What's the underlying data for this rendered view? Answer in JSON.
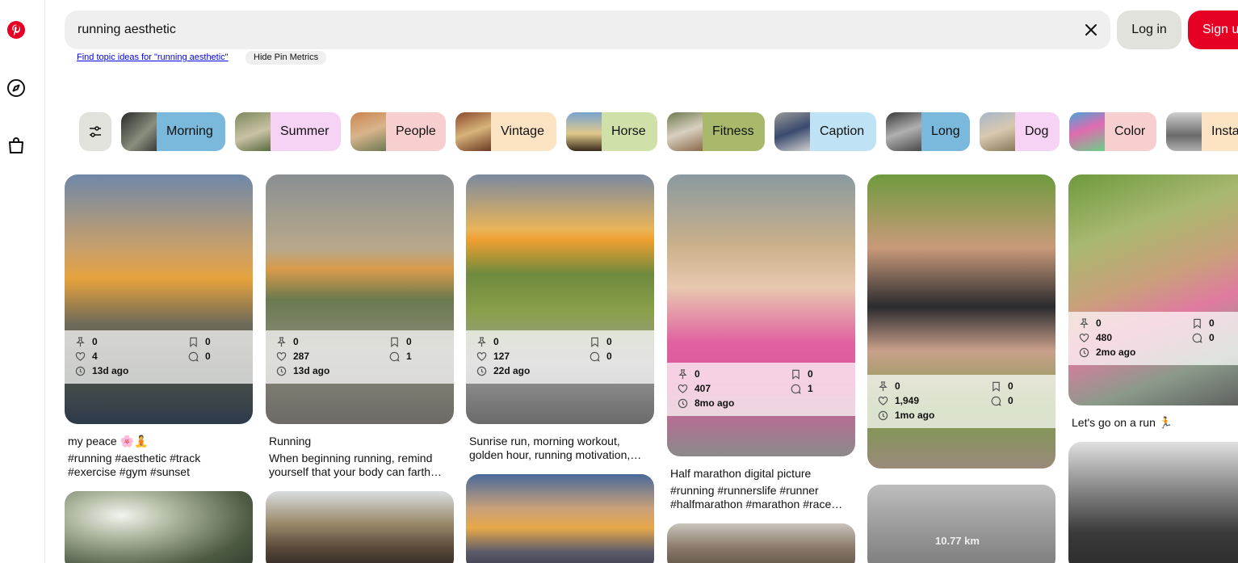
{
  "search": {
    "query": "running aesthetic"
  },
  "header": {
    "login": "Log in",
    "signup": "Sign up"
  },
  "sub": {
    "topic_link": "Find topic ideas for \"running aesthetic\"",
    "hide_metrics": "Hide Pin Metrics"
  },
  "chips": [
    {
      "label": "Morning",
      "color": "#7ab8dc"
    },
    {
      "label": "Summer",
      "color": "#f6d2f4"
    },
    {
      "label": "People",
      "color": "#f8cfcf"
    },
    {
      "label": "Vintage",
      "color": "#fbe3c4"
    },
    {
      "label": "Horse",
      "color": "#cfe0a9"
    },
    {
      "label": "Fitness",
      "color": "#a8b96b"
    },
    {
      "label": "Caption",
      "color": "#bfe3f4"
    },
    {
      "label": "Long",
      "color": "#7ab8dc"
    },
    {
      "label": "Dog",
      "color": "#f6d2f4"
    },
    {
      "label": "Color",
      "color": "#f8cfcf"
    },
    {
      "label": "Insta",
      "color": "#fbe3c4"
    }
  ],
  "pins": [
    {
      "saves": "0",
      "likes": "4",
      "age": "13d ago",
      "bookmarks": "0",
      "comments": "0",
      "title": "my peace 🌸🧘",
      "desc": "#running #aesthetic #track #exercise #gym #sunset"
    },
    {
      "saves": "0",
      "likes": "287",
      "age": "13d ago",
      "bookmarks": "0",
      "comments": "1",
      "title": "Running",
      "desc": "When beginning running, remind yourself that your body can farth…"
    },
    {
      "saves": "0",
      "likes": "127",
      "age": "22d ago",
      "bookmarks": "0",
      "comments": "0",
      "title": "",
      "desc": "Sunrise run, morning workout, golden hour, running motivation,…"
    },
    {
      "saves": "0",
      "likes": "407",
      "age": "8mo ago",
      "bookmarks": "0",
      "comments": "1",
      "title": "Half marathon digital picture",
      "desc": "#running #runnerslife #runner #halfmarathon #marathon #race…"
    },
    {
      "saves": "0",
      "likes": "1,949",
      "age": "1mo ago",
      "bookmarks": "0",
      "comments": "0",
      "title": "",
      "desc": ""
    },
    {
      "saves": "0",
      "likes": "480",
      "age": "2mo ago",
      "bookmarks": "0",
      "comments": "0",
      "title": "Let's go on a run 🏃",
      "desc": ""
    }
  ],
  "overlay_text": "10.77 km",
  "colors": {
    "brand": "#e60023",
    "chip_bg": "#e2e2dc",
    "search_bg": "#efefef"
  }
}
